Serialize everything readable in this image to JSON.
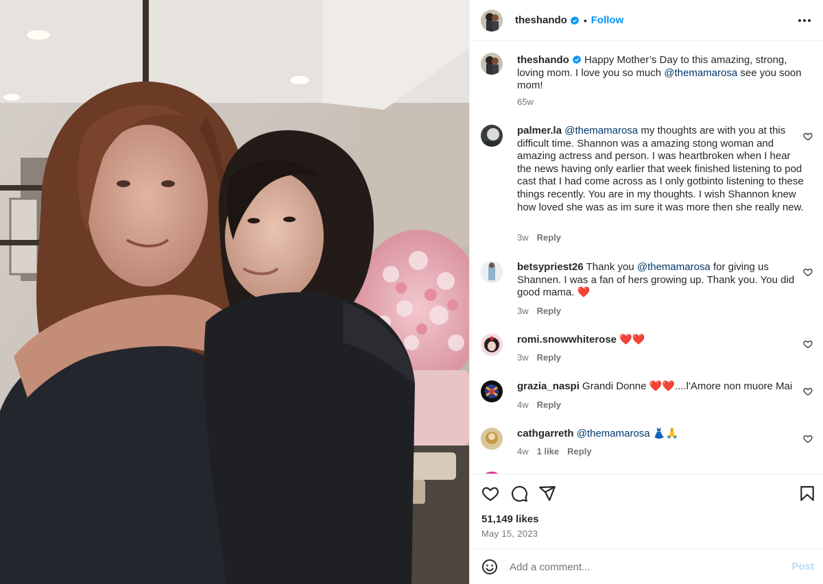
{
  "post": {
    "username": "theshando",
    "follow_label": "Follow",
    "dot": "•",
    "caption": {
      "username": "theshando",
      "text_before": "Happy Mother’s Day to this amazing, strong, loving mom. I love you so much",
      "mention": "@themamarosa",
      "text_after": "see you soon mom!",
      "time": "65w"
    },
    "likes": "51,149 likes",
    "date": "May 15, 2023"
  },
  "comments": [
    {
      "username": "palmer.la",
      "mention": "@themamarosa",
      "text": "my thoughts are with you at this difficult time. Shannon was a amazing stong woman and amazing actress and person. I was heartbroken when I hear the news having only earlier that week finished listening to pod cast that I had come across as I only gotbinto listening to these things recently. You are in my thoughts. I wish Shannon knew how loved she was as im sure it was more then she really new.",
      "time": "3w",
      "reply": "Reply"
    },
    {
      "username": "betsypriest26",
      "text_before": "Thank you",
      "mention": "@themamarosa",
      "text": "for giving us Shannen. I was a fan of hers growing up. Thank you. You did good mama. ❤️",
      "time": "3w",
      "reply": "Reply"
    },
    {
      "username": "romi.snowwhiterose",
      "text": "❤️❤️",
      "time": "3w",
      "reply": "Reply"
    },
    {
      "username": "grazia_naspi",
      "text": "Grandi Donne ❤️❤️....l'Amore non muore Mai",
      "time": "4w",
      "reply": "Reply"
    },
    {
      "username": "cathgarreth",
      "mention": "@themamarosa",
      "text": "👗🙏",
      "time": "4w",
      "likes": "1 like",
      "reply": "Reply"
    }
  ],
  "comment_box": {
    "placeholder": "Add a comment...",
    "post_label": "Post"
  },
  "icons": {
    "verified": "verified-badge-icon",
    "more": "more-options-icon",
    "like": "heart-icon",
    "comment": "comment-icon",
    "share": "share-icon",
    "save": "bookmark-icon",
    "emoji": "emoji-icon"
  },
  "colors": {
    "accent": "#0095f6",
    "mention": "#00376b",
    "muted": "#737373",
    "post_disabled": "#b3dbff"
  }
}
